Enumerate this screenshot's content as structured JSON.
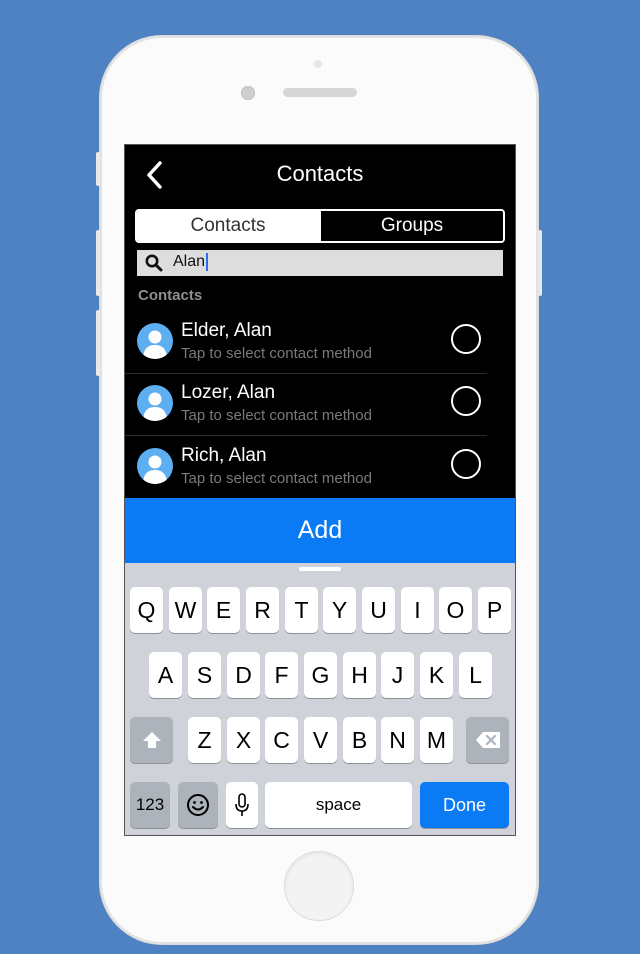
{
  "nav": {
    "title": "Contacts"
  },
  "segments": [
    "Contacts",
    "Groups"
  ],
  "search": {
    "value": "Alan"
  },
  "section_header": "Contacts",
  "contacts": [
    {
      "name": "Elder, Alan",
      "subtitle": "Tap to select contact method"
    },
    {
      "name": "Lozer, Alan",
      "subtitle": "Tap to select contact method"
    },
    {
      "name": "Rich, Alan",
      "subtitle": "Tap to select contact method"
    }
  ],
  "add_label": "Add",
  "keyboard": {
    "row1": [
      "Q",
      "W",
      "E",
      "R",
      "T",
      "Y",
      "U",
      "I",
      "O",
      "P"
    ],
    "row2": [
      "A",
      "S",
      "D",
      "F",
      "G",
      "H",
      "J",
      "K",
      "L"
    ],
    "row3": [
      "Z",
      "X",
      "C",
      "V",
      "B",
      "N",
      "M"
    ],
    "numbers_label": "123",
    "space_label": "space",
    "done_label": "Done"
  },
  "colors": {
    "background": "#4f82c3",
    "accent": "#0b7bf5",
    "avatar": "#5eaef2"
  },
  "icons": [
    "back-chevron-icon",
    "search-icon",
    "person-icon",
    "shift-icon",
    "delete-icon",
    "emoji-icon",
    "microphone-icon"
  ]
}
